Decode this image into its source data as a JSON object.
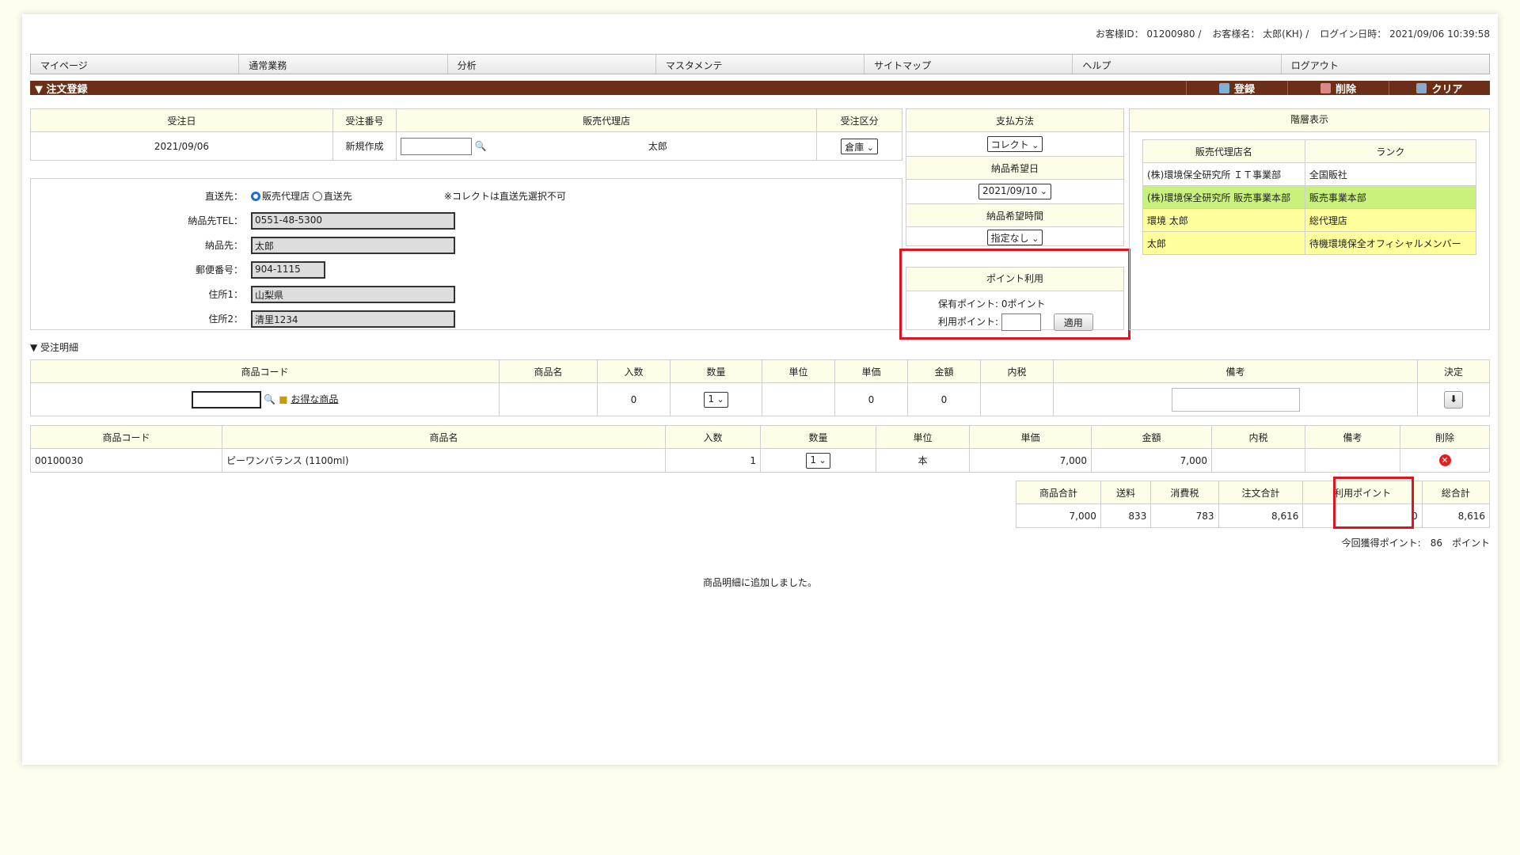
{
  "header": {
    "customer_id": "お客様ID： 01200980 /",
    "customer_name": "お客様名： 太郎(KH) /",
    "login": "ログイン日時： 2021/09/06 10:39:58"
  },
  "nav": [
    "マイページ",
    "通常業務",
    "分析",
    "マスタメンテ",
    "サイトマップ",
    "ヘルプ",
    "ログアウト"
  ],
  "title": "▼ 注文登録",
  "actions": {
    "register": "登録",
    "delete": "削除",
    "clear": "クリア"
  },
  "order": {
    "h_date": "受注日",
    "h_no": "受注番号",
    "h_agent": "販売代理店",
    "h_kind": "受注区分",
    "date": "2021/09/06",
    "no": "新規作成",
    "agent": "太郎",
    "kind": "倉庫"
  },
  "ship": {
    "dest_label": "直送先：",
    "opt_agent": "販売代理店",
    "opt_direct": "直送先",
    "note": "※コレクトは直送先選択不可",
    "tel_label": "納品先TEL：",
    "tel": "0551-48-5300",
    "to_label": "納品先：",
    "to": "太郎",
    "zip_label": "郵便番号：",
    "zip": "904-1115",
    "addr1_label": "住所1：",
    "addr1": "山梨県",
    "addr2_label": "住所2：",
    "addr2": "清里1234"
  },
  "payment": {
    "h_method": "支払方法",
    "method": "コレクト",
    "h_date": "納品希望日",
    "date": "2021/09/10",
    "h_time": "納品希望時間",
    "time": "指定なし"
  },
  "points": {
    "h": "ポイント利用",
    "held": "保有ポイント: 0ポイント",
    "use_label": "利用ポイント:",
    "apply": "適用"
  },
  "hierarchy": {
    "h": "階層表示",
    "h_name": "販売代理店名",
    "h_rank": "ランク",
    "rows": [
      {
        "name": "(株)環境保全研究所 ＩＴ事業部",
        "rank": "全国販社"
      },
      {
        "name": "(株)環境保全研究所 販売事業本部",
        "rank": "販売事業本部"
      },
      {
        "name": "環境 太郎",
        "rank": "総代理店"
      },
      {
        "name": "太郎",
        "rank": "待機環境保全オフィシャルメンバー"
      }
    ]
  },
  "detail_title": "▼ 受注明細",
  "entry": {
    "h": [
      "商品コード",
      "商品名",
      "入数",
      "数量",
      "単位",
      "単価",
      "金額",
      "内税",
      "備考",
      "決定"
    ],
    "deals": "お得な商品",
    "qty": "0",
    "qty_sel": "1",
    "price": "0",
    "amount": "0"
  },
  "lines": {
    "h": [
      "商品コード",
      "商品名",
      "入数",
      "数量",
      "単位",
      "単価",
      "金額",
      "内税",
      "備考",
      "削除"
    ],
    "rows": [
      {
        "code": "00100030",
        "name": "ピーワンバランス (1100ml)",
        "per": "1",
        "qty": "1",
        "unit": "本",
        "price": "7,000",
        "amount": "7,000"
      }
    ]
  },
  "totals": {
    "h": [
      "商品合計",
      "送料",
      "消費税",
      "注文合計",
      "利用ポイント",
      "総合計"
    ],
    "v": [
      "7,000",
      "833",
      "783",
      "8,616",
      "0",
      "8,616"
    ]
  },
  "earned": "今回獲得ポイント:　86　ポイント",
  "message": "商品明細に追加しました。"
}
